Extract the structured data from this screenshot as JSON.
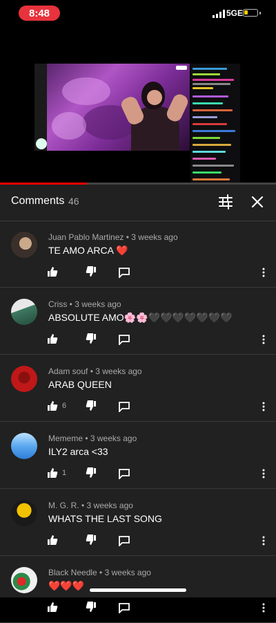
{
  "status_bar": {
    "time": "8:48",
    "network": "5GE"
  },
  "video": {
    "progress_fraction": 0.315
  },
  "comments_panel": {
    "title": "Comments",
    "count": "46",
    "icons": {
      "filter": "tune-icon",
      "close": "close-icon"
    }
  },
  "comments": [
    {
      "author": "Juan Pablo Martinez",
      "time": "3 weeks ago",
      "meta": "Juan Pablo Martinez • 3 weeks ago",
      "text": "TE AMO ARCA ❤️",
      "likes": ""
    },
    {
      "author": "Criss",
      "time": "3 weeks ago",
      "meta": "Criss • 3 weeks ago",
      "text": "ABSOLUTE AMO🌸🌸🖤🖤🖤🖤🖤🖤🖤",
      "likes": ""
    },
    {
      "author": "Adam souf",
      "time": "3 weeks ago",
      "meta": "Adam souf • 3 weeks ago",
      "text": "ARAB QUEEN",
      "likes": "6"
    },
    {
      "author": "Mememe",
      "time": "3 weeks ago",
      "meta": "Mememe • 3 weeks ago",
      "text": "ILY2 arca <33",
      "likes": "1"
    },
    {
      "author": "M. G. R.",
      "time": "3 weeks ago",
      "meta": "M. G. R. • 3 weeks ago",
      "text": "WHATS THE LAST SONG",
      "likes": ""
    },
    {
      "author": "Black Needle",
      "time": "3 weeks ago",
      "meta": "Black Needle • 3 weeks ago",
      "text": "❤️❤️❤️",
      "likes": ""
    }
  ]
}
